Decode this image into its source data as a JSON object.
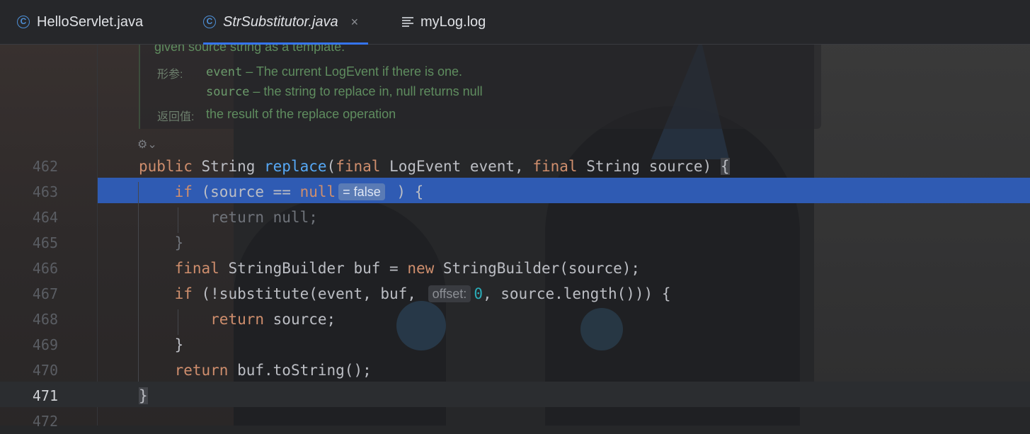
{
  "tabs": [
    {
      "label": "HelloServlet.java",
      "icon": "class-icon",
      "active": false
    },
    {
      "label": "StrSubstitutor.java",
      "icon": "class-icon",
      "active": true,
      "close": "×"
    },
    {
      "label": "myLog.log",
      "icon": "text-file-icon",
      "active": false
    }
  ],
  "doc": {
    "line1": "given source string as a template.",
    "params_tag": "形参:",
    "param1_name": "event",
    "param1_desc": " – The current LogEvent if there is one.",
    "param2_name": "source",
    "param2_desc": " – the string to replace in, null returns null",
    "returns_tag": "返回值:",
    "returns_desc": "the result of the replace operation"
  },
  "reader_icon": "⚙⌄",
  "code": {
    "line_numbers": [
      "462",
      "463",
      "464",
      "465",
      "466",
      "467",
      "468",
      "469",
      "470",
      "471",
      "472"
    ],
    "l462": {
      "a": "public",
      "b": " String ",
      "c": "replace",
      "d": "(",
      "e": "final",
      "f": " LogEvent event, ",
      "g": "final",
      "h": " String source) ",
      "i": "{"
    },
    "l463": {
      "indent": "    ",
      "a": "if",
      "b": " (source == ",
      "c": "null",
      "hint": "= false",
      "d": " ) {"
    },
    "l464": {
      "text": "        return null;"
    },
    "l465": {
      "text": "    }"
    },
    "l466": {
      "indent": "    ",
      "a": "final",
      "b": " StringBuilder buf = ",
      "c": "new",
      "d": " StringBuilder(source);"
    },
    "l467": {
      "indent": "    ",
      "a": "if",
      "b": " (!substitute(event, buf, ",
      "hint": "offset:",
      "c": "0",
      "d": ", source.length())) {"
    },
    "l468": {
      "indent": "        ",
      "a": "return",
      "b": " source;"
    },
    "l469": {
      "text": "    }"
    },
    "l470": {
      "indent": "    ",
      "a": "return",
      "b": " buf.toString();"
    },
    "l471": {
      "text": "}"
    }
  },
  "colors": {
    "accent": "#3574f0",
    "execution_line": "#2f5bb3",
    "keyword": "#cf8e6d",
    "function": "#56a8f5",
    "number": "#2aacb8"
  }
}
